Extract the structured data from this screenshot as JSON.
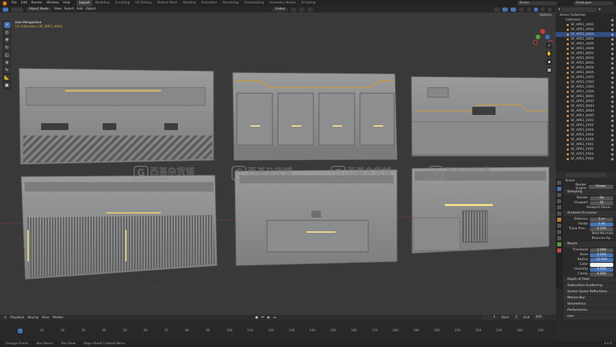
{
  "topbar": {
    "menu": [
      "File",
      "Edit",
      "Render",
      "Window",
      "Help"
    ],
    "tabs": [
      "Layout",
      "Modeling",
      "Sculpting",
      "UV Editing",
      "Texture Paint",
      "Shading",
      "Animation",
      "Rendering",
      "Compositing",
      "Geometry Nodes",
      "Scripting"
    ],
    "active_tab": "Layout",
    "scene": "Scene",
    "view_layer": "ViewLayer"
  },
  "viewport_header": {
    "mode": "Object Mode",
    "menu": [
      "View",
      "Select",
      "Add",
      "Object"
    ],
    "orientation": "Global",
    "options": "Options"
  },
  "viewport": {
    "view_name": "User Perspective",
    "collection_info": "(1) Collection | SF_APE1_A003"
  },
  "watermark": {
    "brand": "西基杂货铺",
    "url": "cgjoy.com"
  },
  "outliner": {
    "title": "Scene Collection",
    "collection": "Collection",
    "items": [
      "SF_APE1_A001",
      "SF_APE1_A002",
      "SF_APE1_A003",
      "SF_APE1_A004",
      "SF_APE1_A005",
      "SF_APE1_A006",
      "SF_APE1_B001",
      "SF_APE1_B002",
      "SF_APE1_B003",
      "SF_APE1_B004",
      "SF_APE1_B005",
      "SF_APE1_C001",
      "SF_APE1_C002",
      "SF_APE1_C003",
      "SF_APE1_C004",
      "SF_APE1_D001",
      "SF_APE1_D002",
      "SF_APE1_D003",
      "SF_APE1_D004",
      "SF_APE1_D005",
      "SF_APE1_E001",
      "SF_APE1_E002",
      "SF_APE1_E003",
      "SF_APE1_E004",
      "SF_APE1_E005",
      "SF_APE1_F001",
      "SF_APE1_F002",
      "SF_APE1_F003",
      "SF_APE1_F004"
    ]
  },
  "properties": {
    "scene": "Scene",
    "render_engine_label": "Render Engine",
    "render_engine": "Eevee",
    "sampling": {
      "title": "Sampling",
      "render_label": "Render",
      "render": "64",
      "viewport_label": "Viewport",
      "viewport": "16",
      "denoise": "Viewport Denoi..."
    },
    "ao": {
      "title": "Ambient Occlusion",
      "distance_label": "Distance",
      "distance": "5 m",
      "factor_label": "Factor",
      "factor": "1.00",
      "trace_label": "Trace Prec...",
      "trace": "0.250",
      "bent": "Bent Normals",
      "bounce": "Bounces Ap..."
    },
    "bloom": {
      "title": "Bloom",
      "threshold_label": "Threshold",
      "threshold": "2.000",
      "knee_label": "Knee",
      "knee": "0.500",
      "radius_label": "Radius",
      "radius": "10.000",
      "color_label": "Color",
      "intensity_label": "Intensity",
      "intensity": "0.050",
      "clamp_label": "Clamp",
      "clamp": "0.000"
    },
    "collapsed": [
      "Depth of Field",
      "Subsurface Scattering",
      "Screen Space Reflections",
      "Motion Blur",
      "Volumetrics",
      "Performance",
      "Hair"
    ]
  },
  "timeline": {
    "menu": [
      "Playback",
      "Keying",
      "View",
      "Marker"
    ],
    "current_frame": "1",
    "start_label": "Start",
    "start": "1",
    "end_label": "End",
    "end": "250",
    "ticks": [
      "1",
      "10",
      "20",
      "30",
      "40",
      "50",
      "60",
      "70",
      "80",
      "90",
      "100",
      "110",
      "120",
      "130",
      "140",
      "150",
      "160",
      "170",
      "180",
      "190",
      "200",
      "210",
      "220",
      "230",
      "240",
      "250"
    ]
  },
  "statusbar": {
    "items": [
      "Change Frame",
      "Box Select",
      "Pan View",
      "Dope Sheet Context Menu"
    ],
    "version": "3.4.0"
  }
}
